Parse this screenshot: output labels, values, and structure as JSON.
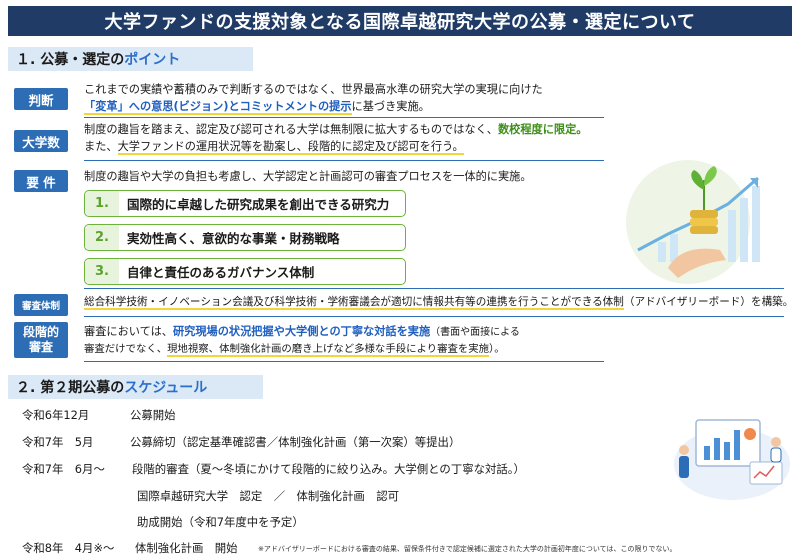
{
  "title": "大学ファンドの支援対象となる国際卓越研究大学の公募・選定について",
  "section1": {
    "heading_main": "１. 公募・選定の",
    "heading_accent": "ポイント"
  },
  "judgement": {
    "label": "判断",
    "line1": "これまでの実績や蓄積のみで判断するのではなく、世界最高水準の研究大学の実現に向けた",
    "line2_highlight": "「変革」への意思(ビジョン)とコミットメントの提示",
    "line2_rest": "に基づき実施。"
  },
  "univ_count": {
    "label": "大学数",
    "line1_main": "制度の趣旨を踏まえ、認定及び認可される大学は無制限に拡大するものではなく、",
    "line1_highlight": "数校程度に限定。",
    "line2_pre": "また、",
    "line2_underlined": "大学ファンドの運用状況等を勘案し、段階的に認定及び認可を行う。"
  },
  "requirements": {
    "label": "要 件",
    "intro": "制度の趣旨や大学の負担も考慮し、大学認定と計画認可の審査プロセスを一体的に実施。",
    "items": [
      {
        "num": "1.",
        "text": "国際的に卓越した研究成果を創出できる研究力"
      },
      {
        "num": "2.",
        "text": "実効性高く、意欲的な事業・財務戦略"
      },
      {
        "num": "3.",
        "text": "自律と責任のあるガバナンス体制"
      }
    ]
  },
  "review_system": {
    "label": "審査体制",
    "text_pre": "総合科学技術・イノベーション会議及び科学技術・学術審議会が適切に情報共有等の連携を行うことができる体制",
    "text_post": "（アドバイザリーボード）を構築。"
  },
  "staged_review": {
    "label_line1": "段階的",
    "label_line2": "審査",
    "line1_pre": "審査においては、",
    "line1_highlight": "研究現場の状況把握や大学側との丁寧な対話を実施",
    "line1_post": "（書面や面接による",
    "line2_pre": "審査だけでなく、",
    "line2_underlined": "現地視察、体制強化計画の磨き上げなど多様な手段により審査を実施",
    "line2_post": "）。"
  },
  "section2": {
    "heading_main": "２. 第２期公募の",
    "heading_accent": "スケジュール"
  },
  "schedule": [
    {
      "date": "令和6年12月",
      "event": "公募開始"
    },
    {
      "date": "令和7年　5月",
      "event": "公募締切（認定基準確認書／体制強化計画（第一次案）等提出）"
    },
    {
      "date": "令和7年　6月～",
      "event": "段階的審査（夏～冬頃にかけて段階的に絞り込み。大学側との丁寧な対話。）"
    },
    {
      "date": "",
      "event": "国際卓越研究大学　認定　／　体制強化計画　認可"
    },
    {
      "date": "",
      "event": "助成開始（令和7年度中を予定）"
    },
    {
      "date": "令和8年　4月※～",
      "event": "体制強化計画　開始"
    }
  ],
  "footnote": "※アドバイザリーボードにおける審査の結果、留保条件付きで認定候補に選定された大学の計画初年度については、この限りでない。",
  "colors": {
    "navy": "#1f3b66",
    "label_blue": "#2c6db5",
    "accent_blue": "#2a6fc9",
    "green": "#6bb33a",
    "underline_yellow": "#f2d43c"
  }
}
